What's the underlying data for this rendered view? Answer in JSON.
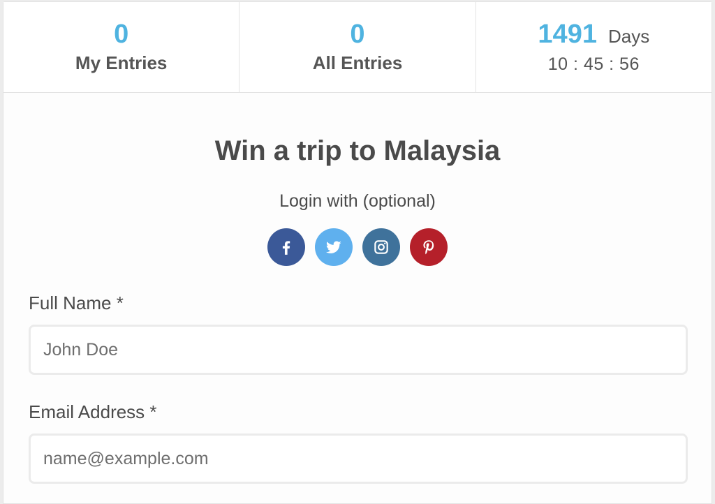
{
  "stats": {
    "my_entries": {
      "value": "0",
      "label": "My Entries"
    },
    "all_entries": {
      "value": "0",
      "label": "All Entries"
    },
    "countdown": {
      "days_value": "1491",
      "days_label": "Days",
      "time": "10 : 45 : 56"
    }
  },
  "title": "Win a trip to Malaysia",
  "login": {
    "label": "Login with (optional)",
    "providers": [
      {
        "name": "facebook-icon",
        "color": "#3b5998"
      },
      {
        "name": "twitter-icon",
        "color": "#55acee"
      },
      {
        "name": "instagram-icon",
        "color": "#3f729b"
      },
      {
        "name": "pinterest-icon",
        "color": "#bd081c"
      }
    ]
  },
  "form": {
    "full_name": {
      "label": "Full Name *",
      "placeholder": "John Doe"
    },
    "email": {
      "label": "Email Address *",
      "placeholder": "name@example.com"
    }
  },
  "colors": {
    "accent": "#4fb3e0",
    "text": "#4a4a4a"
  }
}
